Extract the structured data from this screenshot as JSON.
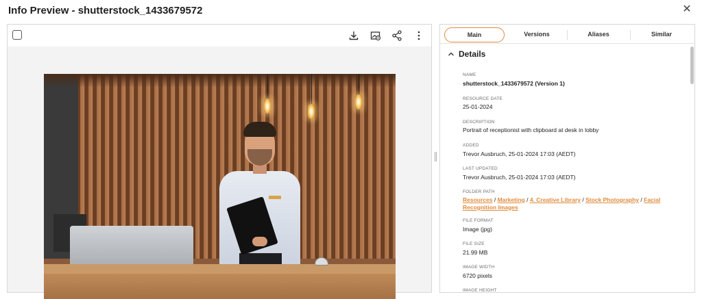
{
  "dialog": {
    "title": "Info Preview - shutterstock_1433679572"
  },
  "tabs": [
    {
      "label": "Main",
      "active": true
    },
    {
      "label": "Versions"
    },
    {
      "label": "Aliases"
    },
    {
      "label": "Similar"
    }
  ],
  "details": {
    "section_title": "Details",
    "fields": [
      {
        "label": "NAME",
        "value": "shutterstock_1433679572 (Version 1)"
      },
      {
        "label": "RESOURCE DATE",
        "value": "25-01-2024"
      },
      {
        "label": "DESCRIPTION",
        "value": "Portrait of receptionist with clipboard at desk in lobby"
      },
      {
        "label": "ADDED",
        "value": "Trevor Ausbruch, 25-01-2024 17:03 (AEDT)"
      },
      {
        "label": "LAST UPDATED",
        "value": "Trevor Ausbruch, 25-01-2024 17:03 (AEDT)"
      },
      {
        "label": "FOLDER PATH",
        "value": ""
      },
      {
        "label": "FILE FORMAT",
        "value": "Image (jpg)"
      },
      {
        "label": "FILE SIZE",
        "value": "21.99 MB"
      },
      {
        "label": "IMAGE WIDTH",
        "value": "6720 pixels"
      },
      {
        "label": "IMAGE HEIGHT",
        "value": ""
      }
    ],
    "folder_path": [
      "Resources",
      "Marketing",
      "4. Creative Library",
      "Stock Photography",
      "Facial Recognition Images"
    ],
    "path_separator": " / "
  },
  "toolbar": {
    "icons": [
      "download-icon",
      "image-compare-icon",
      "share-icon",
      "more-vertical-icon"
    ]
  },
  "colors": {
    "accent": "#e08b3b"
  }
}
